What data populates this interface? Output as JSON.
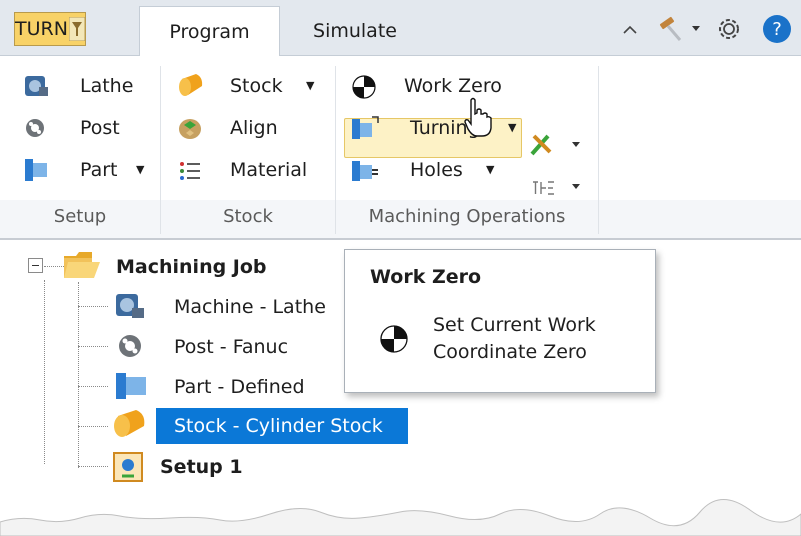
{
  "tab_strip": {
    "turn_label": "TURN",
    "tabs": [
      {
        "label": "Program",
        "active": true
      },
      {
        "label": "Simulate",
        "active": false
      }
    ],
    "right_icons": [
      "collapse-ribbon-icon",
      "hammer-icon",
      "dropdown-caret-icon",
      "gear-icon",
      "help-icon"
    ]
  },
  "ribbon": {
    "groups": [
      {
        "label": "Setup",
        "items": [
          {
            "label": "Lathe",
            "icon": "lathe-machine-icon"
          },
          {
            "label": "Post",
            "icon": "post-processor-icon"
          },
          {
            "label": "Part",
            "icon": "part-icon",
            "dropdown": true
          }
        ]
      },
      {
        "label": "Stock",
        "items": [
          {
            "label": "Stock",
            "icon": "stock-cylinder-icon",
            "dropdown": true
          },
          {
            "label": "Align",
            "icon": "align-icon"
          },
          {
            "label": "Material",
            "icon": "material-list-icon"
          }
        ]
      },
      {
        "label": "Machining Operations",
        "items": [
          {
            "label": "Work Zero",
            "icon": "work-zero-icon",
            "hovered": true
          },
          {
            "label": "Turning",
            "icon": "turning-icon",
            "dropdown": true
          },
          {
            "label": "Holes",
            "icon": "holes-icon",
            "dropdown": true
          }
        ],
        "extra_icons": [
          "tools-icon",
          "thread-icon"
        ]
      }
    ]
  },
  "tree": {
    "root": {
      "label": "Machining Job",
      "expanded": true,
      "toggle": "⊟"
    },
    "children": [
      {
        "label": "Machine - Lathe",
        "icon": "lathe-machine-icon"
      },
      {
        "label": "Post - Fanuc",
        "icon": "post-processor-icon"
      },
      {
        "label": "Part - Defined",
        "icon": "part-icon"
      },
      {
        "label": "Stock - Cylinder Stock",
        "icon": "stock-cylinder-icon",
        "selected": true
      },
      {
        "label": "Setup 1",
        "icon": "setup-icon",
        "bold": true
      }
    ]
  },
  "tooltip": {
    "title": "Work Zero",
    "description": "Set Current Work Coordinate Zero"
  },
  "colors": {
    "turn_button": "#f8d267",
    "selection": "#0b78d7",
    "hover_highlight": "#fdf2c6",
    "tab_strip_bg": "#e3e8ee"
  }
}
